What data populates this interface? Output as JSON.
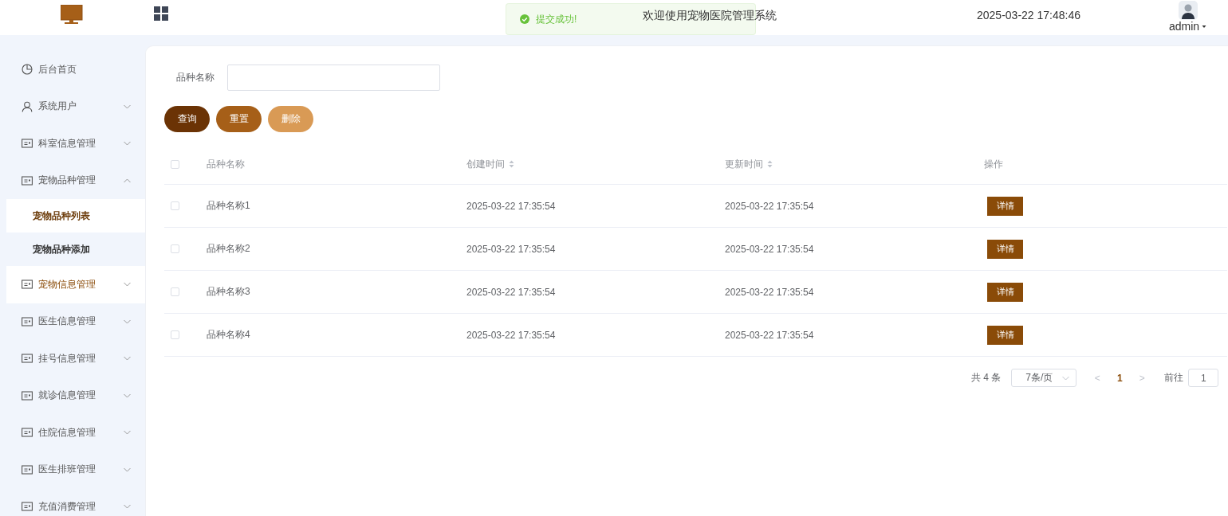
{
  "header": {
    "title": "欢迎使用宠物医院管理系统",
    "datetime": "2025-03-22 17:48:46",
    "user": "admin"
  },
  "toast": {
    "message": "提交成功!"
  },
  "sidebar": {
    "items": [
      {
        "label": "后台首页",
        "kind": "home",
        "selected": false,
        "highlighted": false
      },
      {
        "label": "系统用户",
        "kind": "user",
        "selected": false,
        "highlighted": false,
        "expanded": false
      },
      {
        "label": "科室信息管理",
        "kind": "card",
        "selected": false,
        "highlighted": false,
        "expanded": false
      },
      {
        "label": "宠物品种管理",
        "kind": "card",
        "selected": false,
        "highlighted": false,
        "expanded": true,
        "children": [
          {
            "label": "宠物品种列表",
            "selected": true
          },
          {
            "label": "宠物品种添加",
            "selected": false
          }
        ]
      },
      {
        "label": "宠物信息管理",
        "kind": "card",
        "selected": false,
        "highlighted": true,
        "expanded": false
      },
      {
        "label": "医生信息管理",
        "kind": "card",
        "selected": false,
        "highlighted": false,
        "expanded": false
      },
      {
        "label": "挂号信息管理",
        "kind": "card",
        "selected": false,
        "highlighted": false,
        "expanded": false
      },
      {
        "label": "就诊信息管理",
        "kind": "card",
        "selected": false,
        "highlighted": false,
        "expanded": false
      },
      {
        "label": "住院信息管理",
        "kind": "card",
        "selected": false,
        "highlighted": false,
        "expanded": false
      },
      {
        "label": "医生排班管理",
        "kind": "card",
        "selected": false,
        "highlighted": false,
        "expanded": false
      },
      {
        "label": "充值消费管理",
        "kind": "card",
        "selected": false,
        "highlighted": false,
        "expanded": false
      }
    ]
  },
  "search": {
    "label": "品种名称"
  },
  "buttons": [
    {
      "label": "查询",
      "kind": "query"
    },
    {
      "label": "重置",
      "kind": "reset"
    },
    {
      "label": "删除",
      "kind": "delete"
    }
  ],
  "table": {
    "all_checked": false,
    "columns": [
      {
        "label": "品种名称",
        "sortable": false
      },
      {
        "label": "创建时间",
        "sortable": true
      },
      {
        "label": "更新时间",
        "sortable": true
      },
      {
        "label": "操作",
        "sortable": false
      }
    ],
    "rows": [
      {
        "checked": false,
        "cells": [
          "品种名称1",
          "2025-03-22 17:35:54",
          "2025-03-22 17:35:54"
        ],
        "action": "详情"
      },
      {
        "checked": false,
        "cells": [
          "品种名称2",
          "2025-03-22 17:35:54",
          "2025-03-22 17:35:54"
        ],
        "action": "详情"
      },
      {
        "checked": false,
        "cells": [
          "品种名称3",
          "2025-03-22 17:35:54",
          "2025-03-22 17:35:54"
        ],
        "action": "详情"
      },
      {
        "checked": false,
        "cells": [
          "品种名称4",
          "2025-03-22 17:35:54",
          "2025-03-22 17:35:54"
        ],
        "action": "详情"
      }
    ]
  },
  "pagination": {
    "total": "共 4 条",
    "page_size": "7条/页",
    "prev": "<",
    "pages": [
      {
        "label": "1",
        "selected": true
      }
    ],
    "next": ">",
    "goto_label": "前往",
    "goto_value": "1"
  }
}
